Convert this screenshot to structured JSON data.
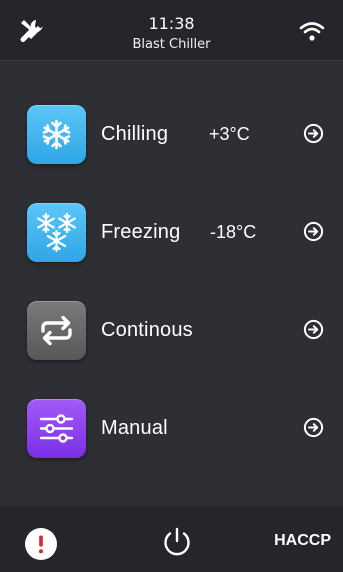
{
  "header": {
    "time": "11:38",
    "title": "Blast Chiller",
    "left_icon": "tools-icon",
    "right_icon": "wifi-icon"
  },
  "menu": [
    {
      "label": "Chilling",
      "temperature": "+3°C",
      "icon": "snowflake-icon",
      "color": "#3fb5f0"
    },
    {
      "label": "Freezing",
      "temperature": "-18°C",
      "icon": "snowflakes-icon",
      "color": "#3fb5f0"
    },
    {
      "label": "Continous",
      "temperature": "",
      "icon": "repeat-icon",
      "color": "#6a6a6a"
    },
    {
      "label": "Manual",
      "temperature": "",
      "icon": "sliders-icon",
      "color": "#8a3ff0"
    }
  ],
  "footer": {
    "alert_icon": "alert-icon",
    "power_icon": "power-icon",
    "haccp_label": "HACCP"
  },
  "colors": {
    "background": "#2e2e35",
    "bar": "#25252b",
    "alert": "#e0203a"
  }
}
